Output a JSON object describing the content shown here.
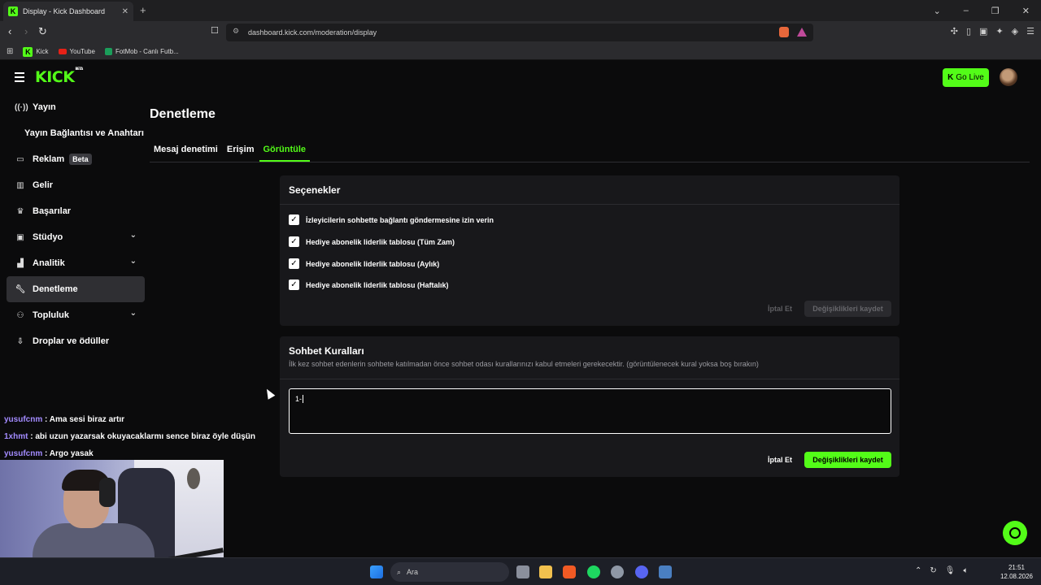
{
  "browser": {
    "tab_title": "Display - Kick Dashboard",
    "url": "dashboard.kick.com/moderation/display",
    "bookmarks": [
      "Kick",
      "YouTube",
      "FotMob - Canlı Futb..."
    ]
  },
  "header": {
    "logo": "KICK",
    "logo_sup": "BETA",
    "go_live": "Go Live"
  },
  "sidebar": {
    "items": [
      {
        "label": "Yayın",
        "icon": "broadcast-icon"
      },
      {
        "label": "Yayın Bağlantısı ve Anahtarı",
        "icon": ""
      },
      {
        "label": "Reklam",
        "icon": "ad-icon",
        "badge": "Beta"
      },
      {
        "label": "Gelir",
        "icon": "revenue-icon"
      },
      {
        "label": "Başarılar",
        "icon": "trophy-icon"
      },
      {
        "label": "Stüdyo",
        "icon": "studio-icon"
      },
      {
        "label": "Analitik",
        "icon": "analytics-icon"
      },
      {
        "label": "Denetleme",
        "icon": "wrench-icon"
      },
      {
        "label": "Topluluk",
        "icon": "community-icon"
      },
      {
        "label": "Droplar ve ödüller",
        "icon": "drops-icon"
      }
    ]
  },
  "main": {
    "title": "Denetleme",
    "tabs": [
      "Mesaj denetimi",
      "Erişim",
      "Görüntüle"
    ],
    "options": {
      "title": "Seçenekler",
      "items": [
        "İzleyicilerin sohbette bağlantı göndermesine izin verin",
        "Hediye abonelik liderlik tablosu (Tüm Zam)",
        "Hediye abonelik liderlik tablosu (Aylık)",
        "Hediye abonelik liderlik tablosu (Haftalık)"
      ],
      "cancel": "İptal Et",
      "save": "Değişiklikleri kaydet"
    },
    "rules": {
      "title": "Sohbet Kuralları",
      "description": "İlk kez sohbet edenlerin sohbete katılmadan önce sohbet odası kurallarınızı kabul etmeleri gerekecektir. (görüntülenecek kural yoksa boş bırakın)",
      "value": "1-",
      "cancel": "İptal Et",
      "save": "Değişiklikleri kaydet"
    }
  },
  "chat": [
    {
      "user": "yusufcnm",
      "text": "Ama sesi biraz artır"
    },
    {
      "user": "1xhmt",
      "text": "abi uzun yazarsak okuyacaklarmı sence biraz öyle düşün"
    },
    {
      "user": "yusufcnm",
      "text": "Argo yasak"
    }
  ],
  "taskbar": {
    "search": "Ara",
    "time": "21:51",
    "date": "12.08.2026"
  },
  "colors": {
    "accent": "#53fc18",
    "bg": "#0b0b0c",
    "card": "#18181b",
    "chat_user": "#a38bff"
  }
}
